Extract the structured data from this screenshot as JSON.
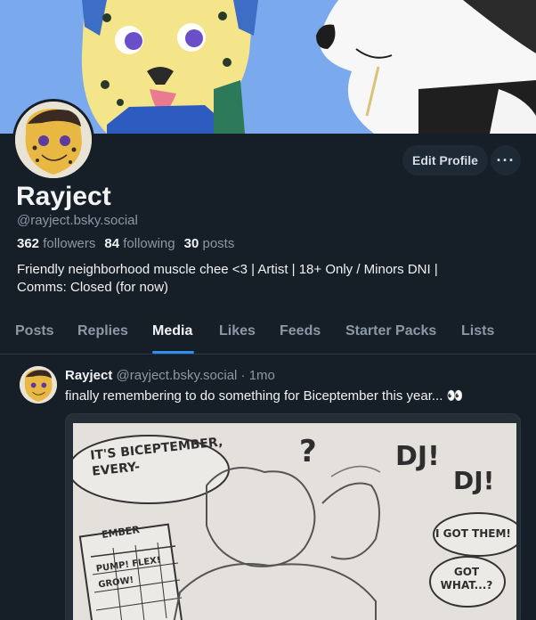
{
  "profile": {
    "display_name": "Rayject",
    "handle": "@rayject.bsky.social",
    "followers_count": "362",
    "followers_label": "followers",
    "following_count": "84",
    "following_label": "following",
    "posts_count": "30",
    "posts_label": "posts",
    "bio_line1": "Friendly neighborhood muscle chee <3 | Artist | 18+ Only / Minors DNI |",
    "bio_line2": "Comms: Closed (for now)"
  },
  "actions": {
    "edit_profile": "Edit Profile",
    "more": "···"
  },
  "tabs": [
    {
      "label": "Posts"
    },
    {
      "label": "Replies"
    },
    {
      "label": "Media"
    },
    {
      "label": "Likes"
    },
    {
      "label": "Feeds"
    },
    {
      "label": "Starter Packs"
    },
    {
      "label": "Lists"
    }
  ],
  "active_tab": "Media",
  "post": {
    "author": "Rayject",
    "handle": "@rayject.bsky.social",
    "separator": "·",
    "time": "1mo",
    "text": "finally remembering to do something for Biceptember this year... 👀",
    "image_text": {
      "bubble1": "IT'S BICEPTEMBER, EVERY-",
      "question": "?",
      "dj1": "DJ!",
      "dj2": "DJ!",
      "got_them": "I GOT THEM!",
      "got_what": "GOT WHAT...?",
      "calendar_header": "EMBER",
      "calendar_words": "PUMP! FLEX! GROW!"
    }
  },
  "colors": {
    "background": "#161e27",
    "accent": "#2f8ef3",
    "muted_text": "#8b98a5",
    "button_bg": "#1e2936"
  }
}
